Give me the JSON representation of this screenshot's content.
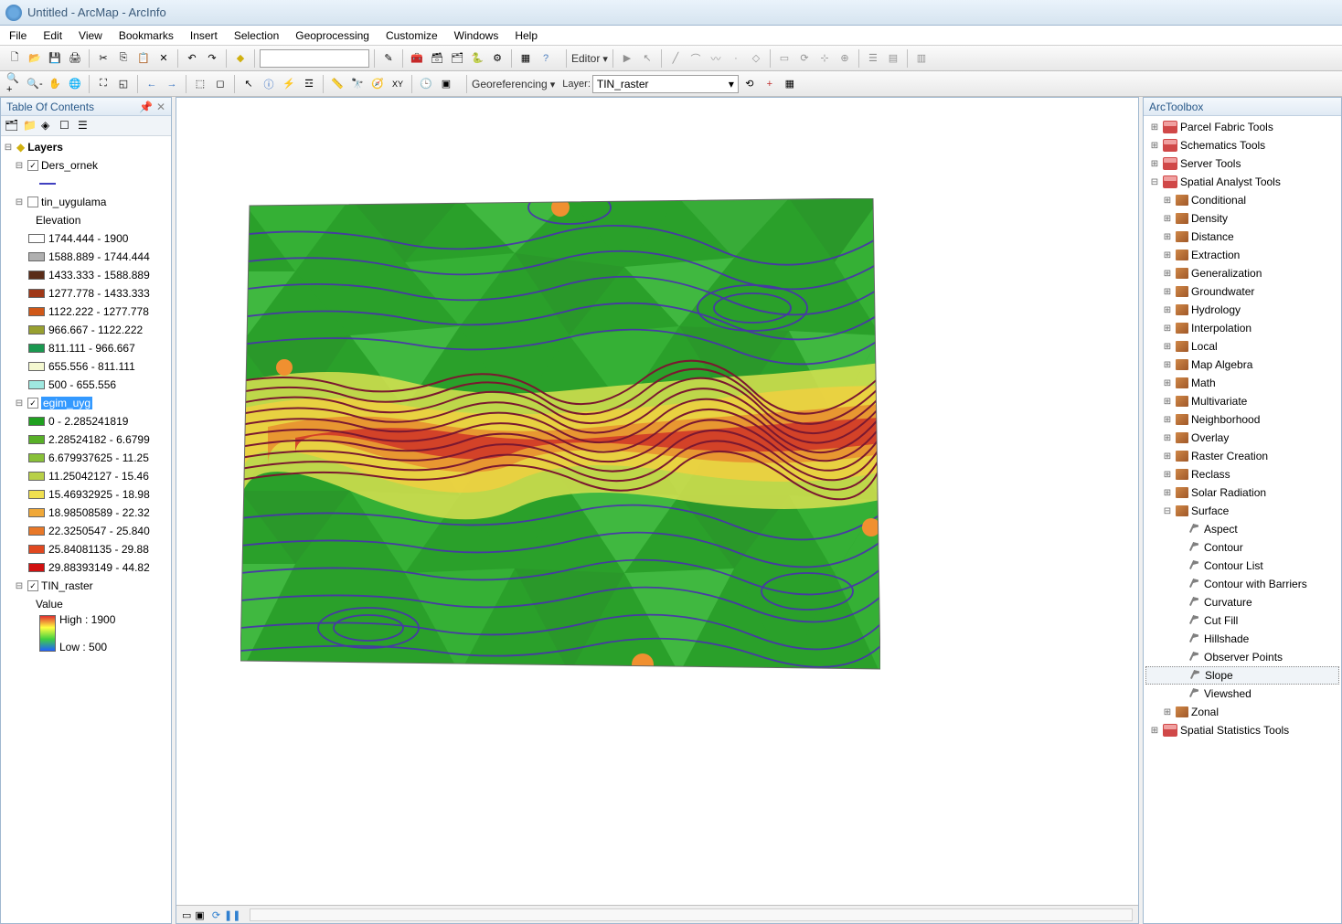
{
  "title": "Untitled - ArcMap - ArcInfo",
  "menu": [
    "File",
    "Edit",
    "View",
    "Bookmarks",
    "Insert",
    "Selection",
    "Geoprocessing",
    "Customize",
    "Windows",
    "Help"
  ],
  "editor_label": "Editor",
  "georef_label": "Georeferencing",
  "layer_label": "Layer:",
  "layer_value": "TIN_raster",
  "toc": {
    "title": "Table Of Contents",
    "root": "Layers",
    "ders": {
      "name": "Ders_ornek",
      "checked": true
    },
    "tin": {
      "name": "tin_uygulama",
      "checked": false,
      "subhead": "Elevation",
      "classes": [
        {
          "c": "#ffffff",
          "t": "1744.444 - 1900"
        },
        {
          "c": "#b0b0b0",
          "t": "1588.889 - 1744.444"
        },
        {
          "c": "#5a2c18",
          "t": "1433.333 - 1588.889"
        },
        {
          "c": "#a03818",
          "t": "1277.778 - 1433.333"
        },
        {
          "c": "#d05818",
          "t": "1122.222 - 1277.778"
        },
        {
          "c": "#98a030",
          "t": "966.667 - 1122.222"
        },
        {
          "c": "#1a9850",
          "t": "811.111 - 966.667"
        },
        {
          "c": "#f4f8d0",
          "t": "655.556 - 811.111"
        },
        {
          "c": "#9fe8e0",
          "t": "500 - 655.556"
        }
      ]
    },
    "egim": {
      "name": "egim_uyg",
      "checked": true,
      "classes": [
        {
          "c": "#20a020",
          "t": "0 - 2.285241819"
        },
        {
          "c": "#58b028",
          "t": "2.28524182 - 6.6799"
        },
        {
          "c": "#88c038",
          "t": "6.679937625 - 11.25"
        },
        {
          "c": "#b8d048",
          "t": "11.25042127 - 15.46"
        },
        {
          "c": "#f0e050",
          "t": "15.46932925 - 18.98"
        },
        {
          "c": "#f0a838",
          "t": "18.98508589 - 22.32"
        },
        {
          "c": "#e87828",
          "t": "22.3250547 - 25.840"
        },
        {
          "c": "#e04820",
          "t": "25.84081135 - 29.88"
        },
        {
          "c": "#d01010",
          "t": "29.88393149 - 44.82"
        }
      ]
    },
    "raster": {
      "name": "TIN_raster",
      "checked": true,
      "subhead": "Value",
      "high": "High : 1900",
      "low": "Low : 500"
    }
  },
  "arctoolbox": {
    "title": "ArcToolbox",
    "boxes_top": [
      "Parcel Fabric Tools",
      "Schematics Tools",
      "Server Tools"
    ],
    "spatial": {
      "name": "Spatial Analyst Tools",
      "sets": [
        "Conditional",
        "Density",
        "Distance",
        "Extraction",
        "Generalization",
        "Groundwater",
        "Hydrology",
        "Interpolation",
        "Local",
        "Map Algebra",
        "Math",
        "Multivariate",
        "Neighborhood",
        "Overlay",
        "Raster Creation",
        "Reclass",
        "Solar Radiation"
      ],
      "surface": {
        "name": "Surface",
        "tools": [
          "Aspect",
          "Contour",
          "Contour List",
          "Contour with Barriers",
          "Curvature",
          "Cut Fill",
          "Hillshade",
          "Observer Points",
          "Slope",
          "Viewshed"
        ]
      },
      "zonal": "Zonal"
    },
    "boxes_bottom": [
      "Spatial Statistics Tools"
    ]
  }
}
